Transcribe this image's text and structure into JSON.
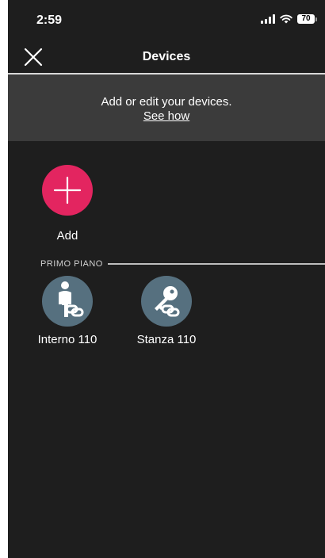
{
  "status_bar": {
    "time": "2:59",
    "battery": "70",
    "icons": [
      "signal-icon",
      "wifi-icon",
      "battery-icon"
    ]
  },
  "nav": {
    "title": "Devices",
    "close_icon": "close-icon"
  },
  "banner": {
    "text": "Add or edit your devices.",
    "link": "See how"
  },
  "add": {
    "label": "Add",
    "icon": "plus-icon",
    "color": "#e32560"
  },
  "section": {
    "title": "PRIMO PIANO"
  },
  "devices": [
    {
      "label": "Interno 110",
      "icon": "person-link-icon"
    },
    {
      "label": "Stanza 110",
      "icon": "key-link-icon"
    }
  ],
  "colors": {
    "background": "#1e1e1e",
    "banner": "#3b3b3b",
    "device_circle": "#56707f"
  }
}
